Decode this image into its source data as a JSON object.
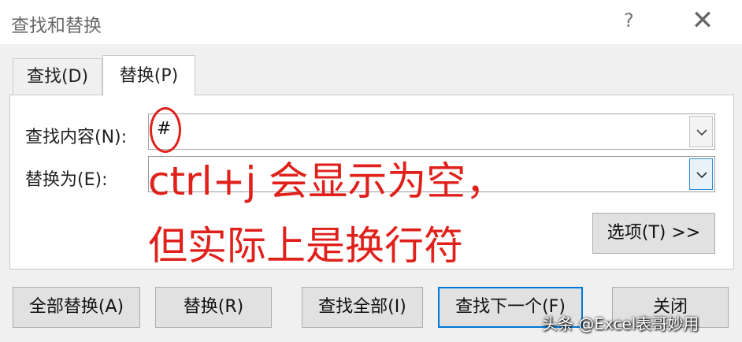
{
  "window": {
    "title": "查找和替换",
    "help_symbol": "?",
    "close_symbol": "✕"
  },
  "tabs": [
    {
      "label": "查找(D)",
      "active": false
    },
    {
      "label": "替换(P)",
      "active": true
    }
  ],
  "find": {
    "label": "查找内容(N):",
    "value": "#"
  },
  "replace": {
    "label": "替换为(E):",
    "value": ""
  },
  "buttons": {
    "options": "选项(T) >>",
    "replace_all": "全部替换(A)",
    "replace": "替换(R)",
    "find_all": "查找全部(I)",
    "find_next": "查找下一个(F)",
    "close": "关闭"
  },
  "annotation": {
    "line1": "ctrl+j 会显示为空，",
    "line2": "但实际上是换行符",
    "color": "#e0201b"
  },
  "watermark": "头条 @Excel表哥妙用",
  "icons": {
    "dropdown": "chevron-down-icon"
  }
}
